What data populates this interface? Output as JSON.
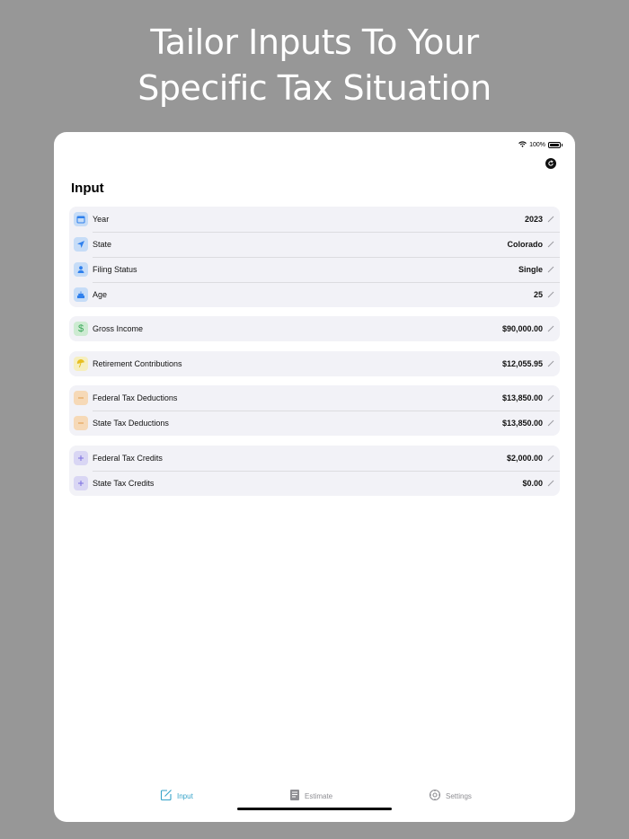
{
  "headline": {
    "line1": "Tailor Inputs To Your",
    "line2": "Specific Tax Situation"
  },
  "status_bar": {
    "battery": "100%"
  },
  "page": {
    "title": "Input"
  },
  "groups": [
    {
      "rows": [
        {
          "label": "Year",
          "value": "2023",
          "icon": "calendar-icon",
          "color": "#2f80ed"
        },
        {
          "label": "State",
          "value": "Colorado",
          "icon": "location-arrow-icon",
          "color": "#2f80ed"
        },
        {
          "label": "Filing Status",
          "value": "Single",
          "icon": "person-icon",
          "color": "#2f80ed"
        },
        {
          "label": "Age",
          "value": "25",
          "icon": "birthday-cake-icon",
          "color": "#2f80ed"
        }
      ]
    },
    {
      "rows": [
        {
          "label": "Gross Income",
          "value": "$90,000.00",
          "icon": "dollar-icon",
          "color": "#3aa85a"
        }
      ]
    },
    {
      "rows": [
        {
          "label": "Retirement Contributions",
          "value": "$12,055.95",
          "icon": "beach-umbrella-icon",
          "color": "#d9b51c"
        }
      ]
    },
    {
      "rows": [
        {
          "label": "Federal Tax Deductions",
          "value": "$13,850.00",
          "icon": "minus-icon",
          "color": "#e39a48"
        },
        {
          "label": "State Tax Deductions",
          "value": "$13,850.00",
          "icon": "minus-icon",
          "color": "#e39a48"
        }
      ]
    },
    {
      "rows": [
        {
          "label": "Federal Tax Credits",
          "value": "$2,000.00",
          "icon": "plus-icon",
          "color": "#7b6ee0"
        },
        {
          "label": "State Tax Credits",
          "value": "$0.00",
          "icon": "plus-icon",
          "color": "#7b6ee0"
        }
      ]
    }
  ],
  "tabbar": {
    "tabs": [
      {
        "label": "Input",
        "icon": "square-pencil-icon",
        "active": true
      },
      {
        "label": "Estimate",
        "icon": "document-icon",
        "active": false
      },
      {
        "label": "Settings",
        "icon": "gear-icon",
        "active": false
      }
    ]
  },
  "colors": {
    "background": "#979797",
    "accent": "#35a3c9",
    "row_background": "#f2f2f7"
  }
}
